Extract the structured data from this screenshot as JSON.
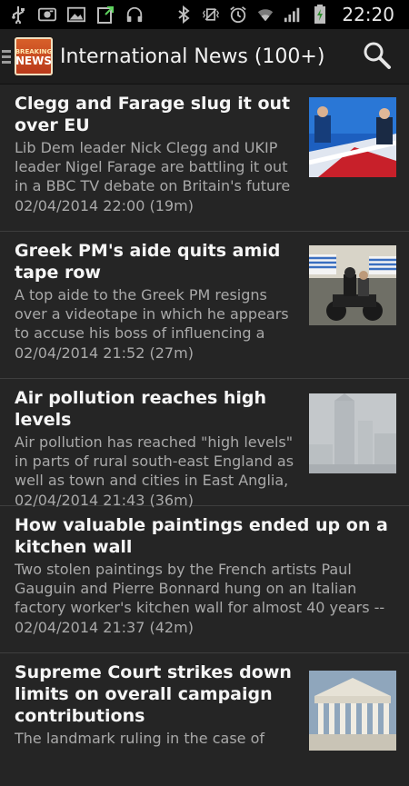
{
  "status_bar": {
    "time": "22:20",
    "icons": [
      "usb-icon",
      "photo-icon",
      "image-icon",
      "download-icon",
      "headphones-icon",
      "bluetooth-icon",
      "vibrate-icon",
      "alarm-icon",
      "wifi-icon",
      "signal-icon",
      "battery-charging-icon"
    ]
  },
  "app_bar": {
    "title": "International News (100+)",
    "logo_line1": "BREAKING",
    "logo_line2": "NEWS"
  },
  "articles": [
    {
      "headline": "Clegg and Farage slug it out over EU",
      "summary": "Lib Dem leader Nick Clegg and UKIP leader Nigel Farage are battling it out in a BBC TV debate on Britain's future in",
      "date": "02/04/2014 22:00 (19m)"
    },
    {
      "headline": "Greek PM's aide quits amid tape row",
      "summary": "A top aide to the Greek PM resigns over a videotape in which he appears to accuse his boss of influencing a",
      "date": "02/04/2014 21:52 (27m)"
    },
    {
      "headline": "Air pollution reaches high levels",
      "summary": "Air pollution has reached \"high levels\" in parts of rural south-east England as well as town and cities in East Anglia, Defra",
      "date": "02/04/2014 21:43 (36m)"
    },
    {
      "headline": "How valuable paintings ended up on a kitchen wall",
      "summary": "Two stolen paintings by the French artists Paul Gauguin and Pierre Bonnard hung on an Italian factory worker's kitchen wall for almost 40 years --",
      "date": "02/04/2014 21:37 (42m)"
    },
    {
      "headline": "Supreme Court strikes down limits on overall campaign contributions",
      "summary": "The landmark ruling in the case of",
      "date": ""
    }
  ]
}
